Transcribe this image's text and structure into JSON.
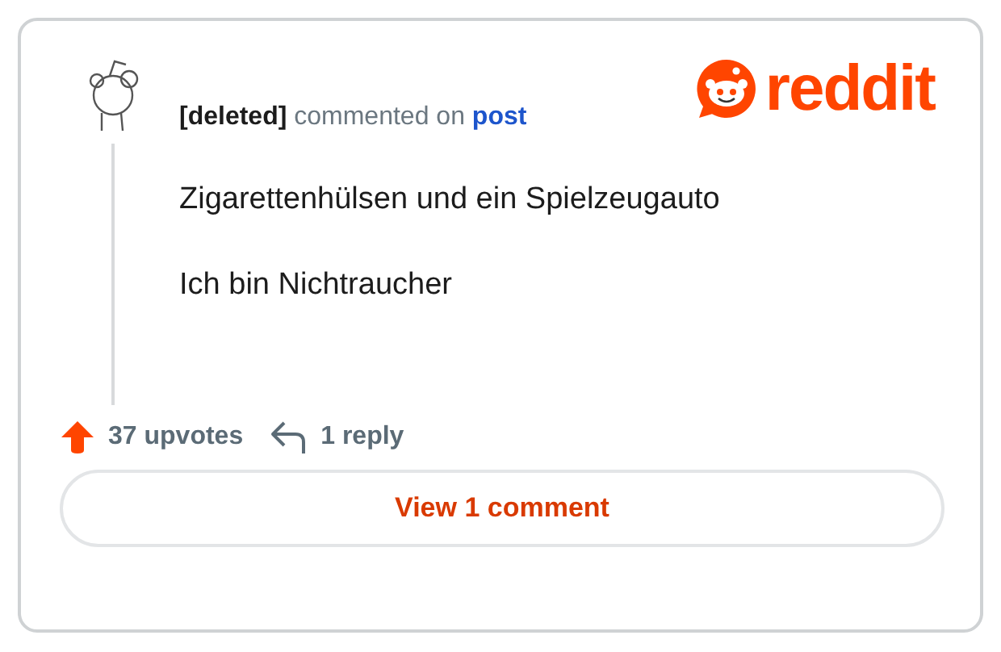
{
  "comment": {
    "author": "[deleted]",
    "action": "commented on",
    "target": "post",
    "paragraphs": [
      "Zigarettenhülsen und ein Spielzeugauto",
      "Ich bin Nichtraucher"
    ]
  },
  "logo": {
    "wordmark": "reddit"
  },
  "footer": {
    "upvotes": "37 upvotes",
    "replies": "1 reply"
  },
  "button": {
    "label": "View 1 comment"
  }
}
